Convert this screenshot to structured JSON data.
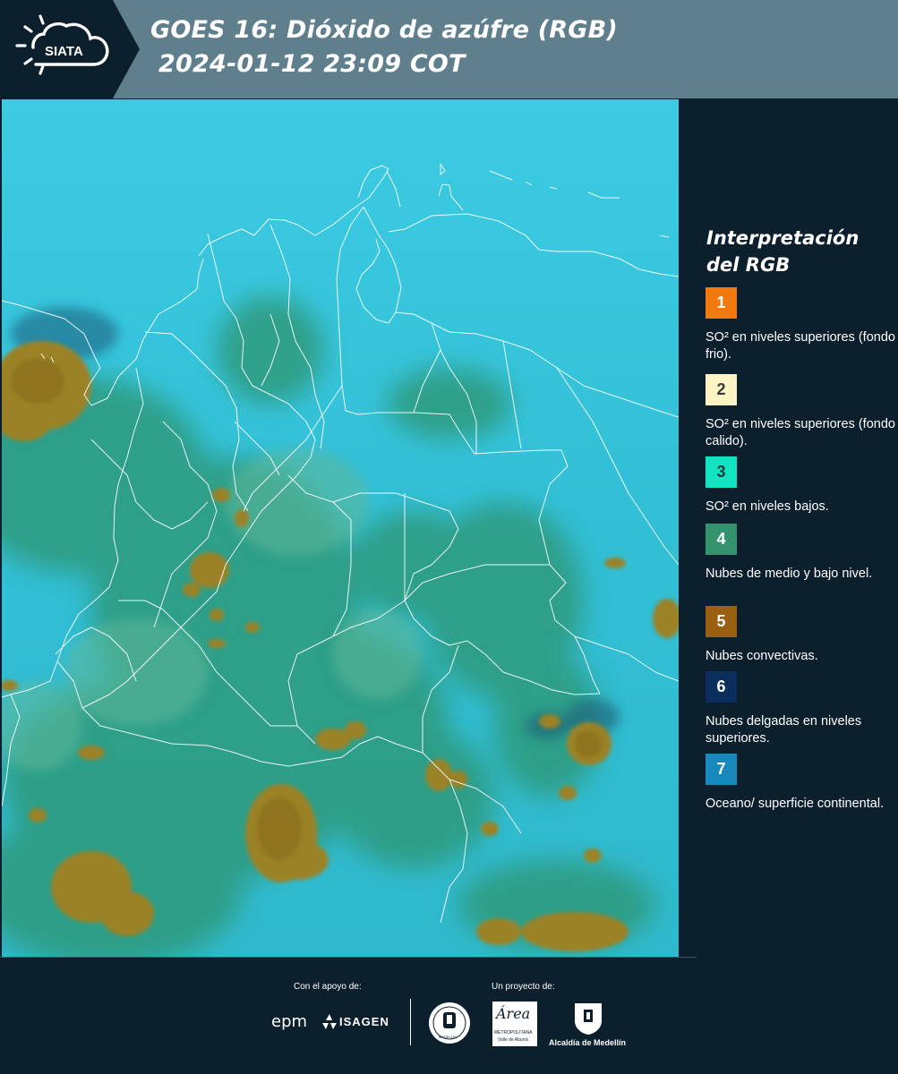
{
  "header": {
    "brand": "SIATA",
    "title_line1": "GOES 16: Dióxido de azúfre (RGB)",
    "title_line2": "2024-01-12 23:09 COT"
  },
  "legend": {
    "title_line1": "Interpretación",
    "title_line2": "del RGB",
    "items": [
      {
        "number": "1",
        "color": "#f07a10",
        "text_color": "#ffffff",
        "label": "SO² en niveles superiores (fondo frio)."
      },
      {
        "number": "2",
        "color": "#fcf4c4",
        "text_color": "#3a3a3a",
        "label": "SO² en niveles superiores (fondo calido)."
      },
      {
        "number": "3",
        "color": "#12e3c2",
        "text_color": "#1c3c3c",
        "label": "SO² en niveles bajos."
      },
      {
        "number": "4",
        "color": "#34926c",
        "text_color": "#ffffff",
        "label": "Nubes de medio y bajo nivel."
      },
      {
        "number": "5",
        "color": "#9a5f10",
        "text_color": "#ffffff",
        "label": "Nubes convectivas."
      },
      {
        "number": "6",
        "color": "#0a2f5f",
        "text_color": "#ffffff",
        "label": "Nubes delgadas en niveles superiores."
      },
      {
        "number": "7",
        "color": "#1789bd",
        "text_color": "#ffffff",
        "label": "Oceano/ superficie continental."
      }
    ]
  },
  "footer": {
    "support_label": "Con el apoyo de:",
    "project_label": "Un proyecto de:",
    "sponsor_1": "epm",
    "sponsor_2": "ISAGEN",
    "partner_1": "MEDELLÍN",
    "partner_2_a": "Área",
    "partner_2_b": "METROPOLITANA",
    "partner_2_c": "Valle de Aburrá",
    "partner_3": "Alcaldía de Medellín"
  },
  "colors": {
    "header_bg": "#5f7f8c",
    "panel_bg": "#0c1f2d",
    "map_cyan": "#38c2d8",
    "map_green": "#2f9a78",
    "map_brown": "#9a7f2a",
    "border_lines": "#ffffff"
  }
}
